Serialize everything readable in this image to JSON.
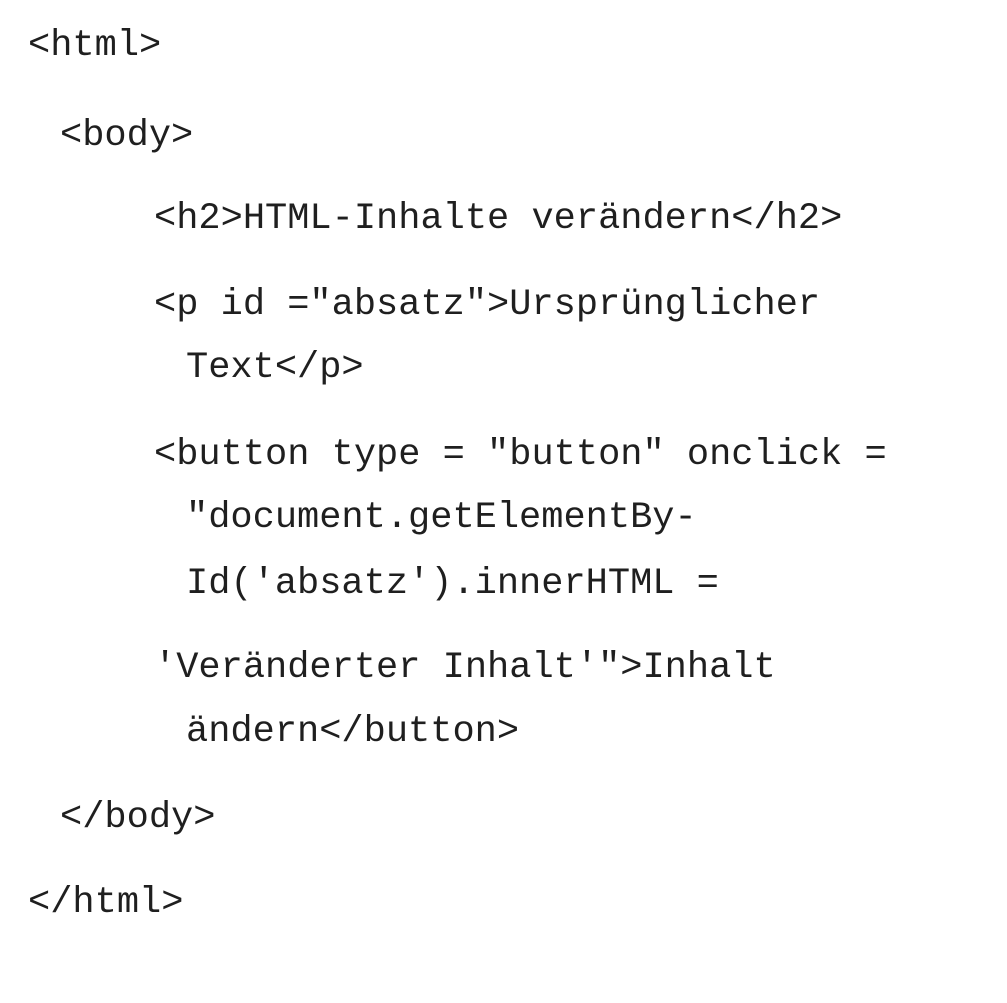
{
  "code": {
    "lines": [
      "<html>",
      "<body>",
      "<h2>HTML-Inhalte verändern</h2>",
      "<p id =\"absatz\">Ursprünglicher",
      "Text</p>",
      "<button type = \"button\" onclick =",
      "\"document.getElementBy-",
      "Id('absatz').innerHTML =",
      "'Veränderter Inhalt'\">Inhalt",
      "ändern</button>",
      "</body>",
      "</html>"
    ]
  }
}
